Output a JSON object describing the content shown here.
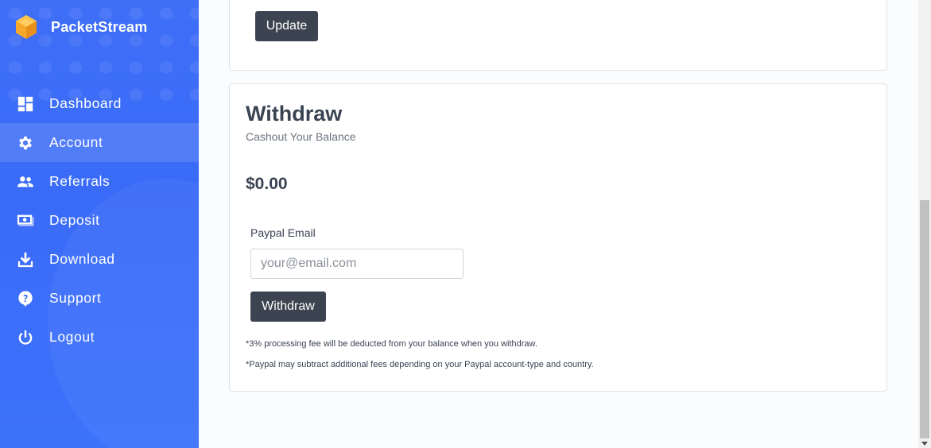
{
  "brand": {
    "name": "PacketStream"
  },
  "sidebar": {
    "items": [
      {
        "label": "Dashboard",
        "icon": "dashboard-icon"
      },
      {
        "label": "Account",
        "icon": "gear-icon",
        "active": true
      },
      {
        "label": "Referrals",
        "icon": "users-icon"
      },
      {
        "label": "Deposit",
        "icon": "money-icon"
      },
      {
        "label": "Download",
        "icon": "download-icon"
      },
      {
        "label": "Support",
        "icon": "help-icon"
      },
      {
        "label": "Logout",
        "icon": "power-icon"
      }
    ]
  },
  "top_card": {
    "update_label": "Update"
  },
  "withdraw": {
    "title": "Withdraw",
    "subtitle": "Cashout Your Balance",
    "balance": "$0.00",
    "email_label": "Paypal Email",
    "email_placeholder": "your@email.com",
    "email_value": "",
    "button_label": "Withdraw",
    "note_fee": "*3% processing fee will be deducted from your balance when you withdraw.",
    "note_paypal": "*Paypal may subtract additional fees depending on your Paypal account-type and country."
  },
  "colors": {
    "sidebar_bg": "#3d6ef8",
    "button_bg": "#3d4451",
    "text_dark": "#3a4353",
    "brand_logo": "#f5a623"
  }
}
